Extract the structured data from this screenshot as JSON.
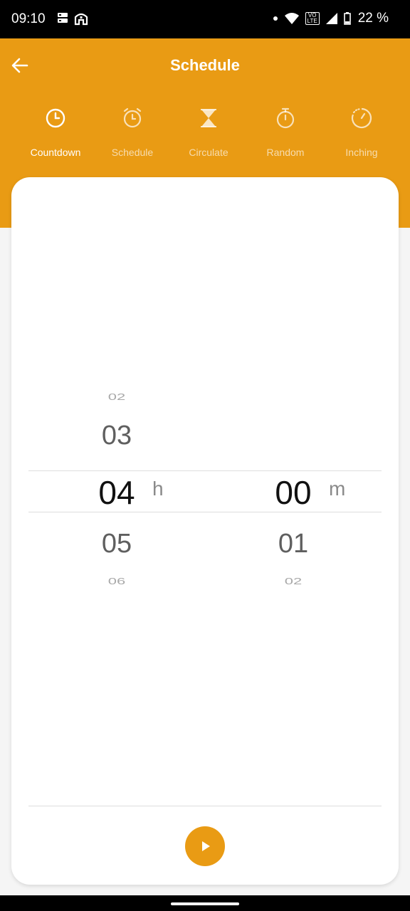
{
  "status_bar": {
    "time": "09:10",
    "battery": "22 %",
    "vo_lte_top": "VO",
    "vo_lte_bottom": "LTE"
  },
  "header": {
    "title": "Schedule"
  },
  "tabs": [
    {
      "label": "Countdown",
      "icon": "clock-icon",
      "active": true
    },
    {
      "label": "Schedule",
      "icon": "alarm-clock-icon",
      "active": false
    },
    {
      "label": "Circulate",
      "icon": "hourglass-icon",
      "active": false
    },
    {
      "label": "Random",
      "icon": "stopwatch-icon",
      "active": false
    },
    {
      "label": "Inching",
      "icon": "dotted-clock-icon",
      "active": false
    }
  ],
  "picker": {
    "hours": {
      "items": [
        "02",
        "03",
        "04",
        "05",
        "06"
      ],
      "selected": "04",
      "unit": "h"
    },
    "minutes": {
      "items": [
        "00",
        "01",
        "02"
      ],
      "selected": "00",
      "unit": "m"
    }
  },
  "colors": {
    "accent": "#e99b14",
    "background": "#f5f5f5"
  }
}
